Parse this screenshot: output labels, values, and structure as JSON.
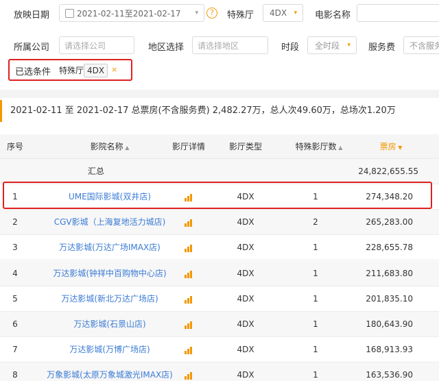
{
  "filters": {
    "date_label": "放映日期",
    "date_range": "2021-02-11至2021-02-17",
    "special_hall_label": "特殊厅",
    "special_hall_value": "4DX",
    "movie_name_label": "电影名称",
    "company_label": "所属公司",
    "company_placeholder": "请选择公司",
    "region_label": "地区选择",
    "region_placeholder": "请选择地区",
    "period_label": "时段",
    "period_value": "全时段",
    "service_fee_label": "服务费",
    "service_fee_value": "不含服务",
    "selected_label": "已选条件",
    "chip_key": "特殊厅",
    "chip_value": "4DX",
    "chip_close": "×"
  },
  "summary": "2021-02-11 至 2021-02-17 总票房(不含服务费) 2,482.27万，总人次49.60万，总场次1.20万",
  "table": {
    "headers": {
      "index": "序号",
      "cinema": "影院名称",
      "hall_detail": "影厅详情",
      "hall_type": "影厅类型",
      "special_count": "特殊影厅数",
      "box_office": "票房"
    },
    "total_label": "汇总",
    "total_value": "24,822,655.55",
    "rows": [
      {
        "idx": "1",
        "name": "UME国际影城(双井店)",
        "type": "4DX",
        "count": "1",
        "box": "274,348.20"
      },
      {
        "idx": "2",
        "name": "CGV影城（上海复地活力城店)",
        "type": "4DX",
        "count": "2",
        "box": "265,283.00"
      },
      {
        "idx": "3",
        "name": "万达影城(万达广场IMAX店)",
        "type": "4DX",
        "count": "1",
        "box": "228,655.78"
      },
      {
        "idx": "4",
        "name": "万达影城(钟祥中百购物中心店)",
        "type": "4DX",
        "count": "1",
        "box": "211,683.80"
      },
      {
        "idx": "5",
        "name": "万达影城(新北万达广场店)",
        "type": "4DX",
        "count": "1",
        "box": "201,835.10"
      },
      {
        "idx": "6",
        "name": "万达影城(石景山店)",
        "type": "4DX",
        "count": "1",
        "box": "180,643.90"
      },
      {
        "idx": "7",
        "name": "万达影城(万博广场店)",
        "type": "4DX",
        "count": "1",
        "box": "168,913.93"
      },
      {
        "idx": "8",
        "name": "万象影城(太原万象城激光IMAX店)",
        "type": "4DX",
        "count": "1",
        "box": "163,536.90"
      }
    ]
  },
  "colors": {
    "accent": "#f39800",
    "link": "#3a7bd5",
    "highlight": "#e02020"
  }
}
